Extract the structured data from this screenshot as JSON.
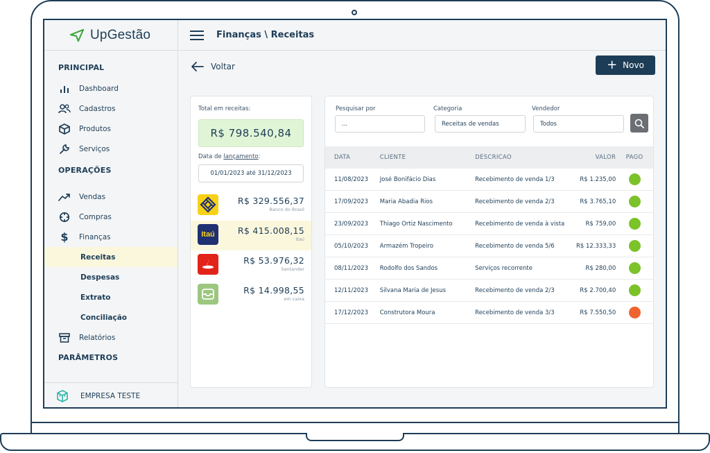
{
  "app": {
    "name": "UpGestão",
    "breadcrumb": "Finanças \\ Receitas"
  },
  "sidebar": {
    "sections": {
      "principal": "PRINCIPAL",
      "operacoes": "OPERAÇÕES",
      "parametros": "PARÂMETROS"
    },
    "principal_items": [
      {
        "label": "Dashboard",
        "icon": "bar-chart-icon"
      },
      {
        "label": "Cadastros",
        "icon": "users-icon"
      },
      {
        "label": "Produtos",
        "icon": "box-icon"
      },
      {
        "label": "Serviços",
        "icon": "wrench-icon"
      }
    ],
    "operacoes_items": [
      {
        "label": "Vendas",
        "icon": "trend-up-icon"
      },
      {
        "label": "Compras",
        "icon": "crosshair-icon"
      },
      {
        "label": "Finanças",
        "icon": "dollar-icon"
      }
    ],
    "financas_sub": [
      "Receitas",
      "Despesas",
      "Extrato",
      "Conciliação"
    ],
    "relatorios": "Relatórios",
    "company": "EMPRESA TESTE"
  },
  "toolbar": {
    "back_label": "Voltar",
    "new_label": "Novo"
  },
  "accounts": {
    "total_label": "Total em receitas:",
    "total_value": "R$ 798.540,84",
    "date_label_prefix": "Data de ",
    "date_label_link": "lançamento",
    "date_label_suffix": ":",
    "date_range": "01/01/2023 até 31/12/2023",
    "banks": [
      {
        "amount": "R$ 329.556,37",
        "name": "Banco do Brasil",
        "logo_color": "#f7d117"
      },
      {
        "amount": "R$ 415.008,15",
        "name": "Itaú",
        "logo_color": "#1e2f72"
      },
      {
        "amount": "R$ 53.976,32",
        "name": "Santander",
        "logo_color": "#e2231a"
      },
      {
        "amount": "R$ 14.998,55",
        "name": "em caixa",
        "logo_color": "#9cc77f"
      }
    ],
    "itau_logo_text": "Itaú"
  },
  "filters": {
    "search_label": "Pesquisar por",
    "search_placeholder": "...",
    "category_label": "Categoria",
    "category_value": "Receitas de vendas",
    "seller_label": "Vendedor",
    "seller_value": "Todos"
  },
  "table": {
    "headers": [
      "DATA",
      "CLIENTE",
      "DESCRICAO",
      "VALOR",
      "PAGO"
    ],
    "rows": [
      {
        "date": "11/08/2023",
        "client": "José Bonifácio Dias",
        "desc": "Recebimento de venda 1/3",
        "value": "R$ 1.235,00",
        "paid": true
      },
      {
        "date": "17/09/2023",
        "client": "Maria Abadia Rios",
        "desc": "Recebimento de venda 2/3",
        "value": "R$ 3.765,10",
        "paid": true
      },
      {
        "date": "23/09/2023",
        "client": "Thiago Ortiz Nascimento",
        "desc": "Recebimento de venda à vista",
        "value": "R$ 759,00",
        "paid": true
      },
      {
        "date": "05/10/2023",
        "client": "Armazém Tropeiro",
        "desc": "Recebimento de venda 5/6",
        "value": "R$ 12.333,33",
        "paid": true
      },
      {
        "date": "08/11/2023",
        "client": "Rodolfo dos Sandos",
        "desc": "Serviços recorrente",
        "value": "R$ 280,00",
        "paid": true
      },
      {
        "date": "12/11/2023",
        "client": "Silvana Maria de Jesus",
        "desc": "Recebimento de venda 2/3",
        "value": "R$ 2.700,40",
        "paid": true
      },
      {
        "date": "17/12/2023",
        "client": "Construtora Moura",
        "desc": "Recebimento de venda 3/3",
        "value": "R$ 7.550,50",
        "paid": false
      }
    ]
  },
  "colors": {
    "primary": "#1d3d57",
    "paid": "#7cc229",
    "unpaid": "#f0622e",
    "highlight": "#fbf7dd",
    "total_bg": "#e0f5d6"
  }
}
